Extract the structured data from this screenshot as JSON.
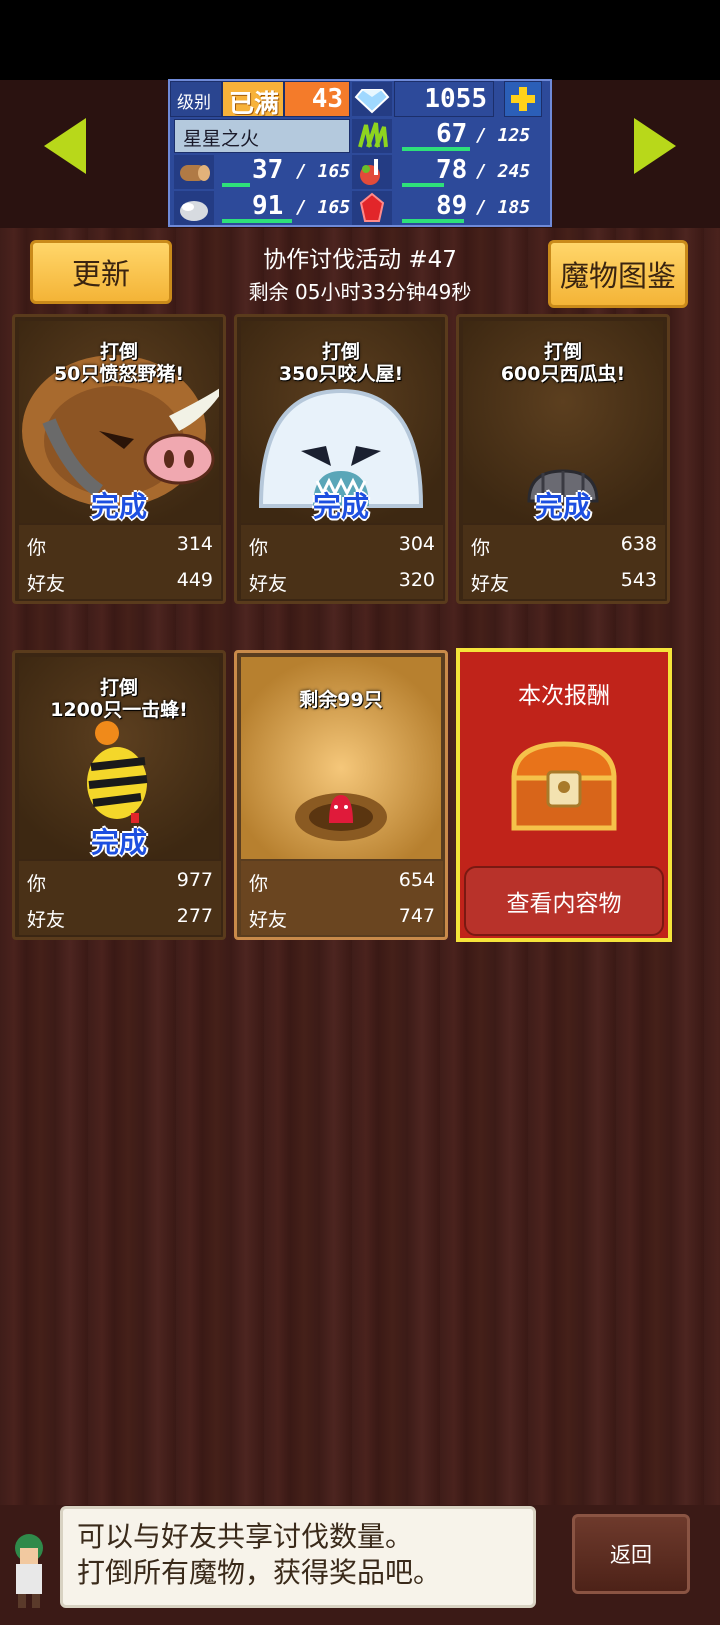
{
  "hud": {
    "level_label": "级别",
    "level_max_badge": "已满",
    "level_value": "43",
    "gems": "1055",
    "player_name": "星星之火",
    "resources": [
      {
        "icon": "grass-icon",
        "current": "67",
        "max": "/ 125",
        "fill": 0.536
      },
      {
        "icon": "wood-log-icon",
        "current": "37",
        "max": "/ 165",
        "fill": 0.224
      },
      {
        "icon": "meat-icon",
        "current": "78",
        "max": "/ 245",
        "fill": 0.318
      },
      {
        "icon": "stone-icon",
        "current": "91",
        "max": "/ 165",
        "fill": 0.552
      },
      {
        "icon": "red-crystal-icon",
        "current": "89",
        "max": "/ 185",
        "fill": 0.481
      }
    ]
  },
  "header": {
    "refresh_label": "更新",
    "event_title": "协作讨伐活动 #47",
    "time_remaining": "剩余 05小时33分钟49秒",
    "monster_book_label": "魔物图鉴"
  },
  "cards": [
    {
      "goal_line1": "打倒",
      "goal_line2": "50只愤怒野猪!",
      "status": "完成",
      "you_label": "你",
      "you": "314",
      "friend_label": "好友",
      "friend": "449"
    },
    {
      "goal_line1": "打倒",
      "goal_line2": "350只咬人屋!",
      "status": "完成",
      "you_label": "你",
      "you": "304",
      "friend_label": "好友",
      "friend": "320"
    },
    {
      "goal_line1": "打倒",
      "goal_line2": "600只西瓜虫!",
      "status": "完成",
      "you_label": "你",
      "you": "638",
      "friend_label": "好友",
      "friend": "543"
    },
    {
      "goal_line1": "打倒",
      "goal_line2": "1200只一击蜂!",
      "status": "完成",
      "you_label": "你",
      "you": "977",
      "friend_label": "好友",
      "friend": "277"
    },
    {
      "remaining": "剩余99只",
      "you_label": "你",
      "you": "654",
      "friend_label": "好友",
      "friend": "747"
    }
  ],
  "reward": {
    "title": "本次报酬",
    "view_label": "查看内容物"
  },
  "dialog": {
    "line1": "可以与好友共享讨伐数量。",
    "line2": "打倒所有魔物，获得奖品吧。"
  },
  "back_label": "返回"
}
